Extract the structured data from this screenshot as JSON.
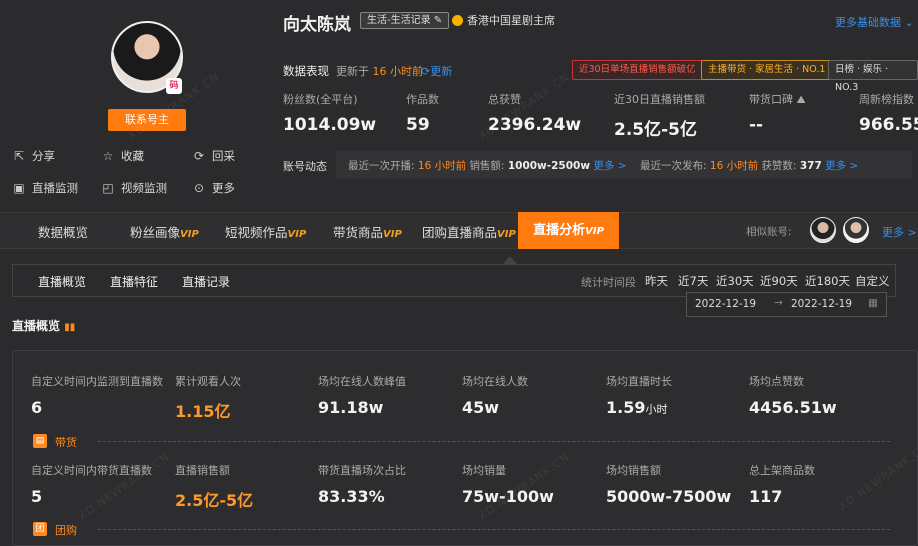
{
  "profile": {
    "name": "向太陈岚",
    "category_tag": "生活-生活记录",
    "certification": "香港中国星剧主席",
    "contact_label": "联系号主",
    "more_data_link": "更多基础数据"
  },
  "actions": [
    {
      "icon": "share-icon",
      "label": "分享"
    },
    {
      "icon": "star-icon",
      "label": "收藏"
    },
    {
      "icon": "refresh-icon",
      "label": "回采"
    },
    {
      "icon": "live-icon",
      "label": "直播监测"
    },
    {
      "icon": "video-icon",
      "label": "视频监测"
    },
    {
      "icon": "more-icon",
      "label": "更多"
    }
  ],
  "performance": {
    "label": "数据表现",
    "updated_prefix": "更新于",
    "updated_time": "16 小时前",
    "refresh_label": "更新",
    "badges": [
      "近30日单场直播销售额破亿",
      "主播带货 · 家居生活 · NO.1",
      "日榜 · 娱乐 · NO.3"
    ]
  },
  "stats": [
    {
      "label": "粉丝数(全平台)",
      "value": "1014.09w"
    },
    {
      "label": "作品数",
      "value": "59"
    },
    {
      "label": "总获赞",
      "value": "2396.24w"
    },
    {
      "label": "近30日直播销售额",
      "value": "2.5亿-5亿"
    },
    {
      "label": "带货口碑",
      "value": "--"
    },
    {
      "label": "周新榜指数",
      "value": "966.55"
    }
  ],
  "account_activity": {
    "label": "账号动态",
    "live_prefix": "最近一次开播:",
    "live_time": "16 小时前",
    "sales_label": "销售额:",
    "sales_value": "1000w-2500w",
    "more1": "更多 >",
    "post_prefix": "最近一次发布:",
    "post_time": "16 小时前",
    "likes_label": "获赞数:",
    "likes_value": "377",
    "more2": "更多 >"
  },
  "tabs": [
    {
      "label": "数据概览",
      "vip": ""
    },
    {
      "label": "粉丝画像",
      "vip": "VIP"
    },
    {
      "label": "短视频作品",
      "vip": "VIP"
    },
    {
      "label": "带货商品",
      "vip": "VIP"
    },
    {
      "label": "团购直播商品",
      "vip": "VIP"
    }
  ],
  "active_tab": {
    "label": "直播分析",
    "vip": "VIP"
  },
  "similar": {
    "label": "相似账号:",
    "more": "更多 >"
  },
  "subtabs": [
    "直播概览",
    "直播特征",
    "直播记录"
  ],
  "period": {
    "label": "统计时间段",
    "options": [
      "昨天",
      "近7天",
      "近30天",
      "近90天",
      "近180天",
      "自定义"
    ],
    "start": "2022-12-19",
    "end": "2022-12-19",
    "arrow": "→"
  },
  "section_title": "直播概览",
  "row1": [
    {
      "label": "自定义时间内监测到直播数",
      "value": "6",
      "unit": ""
    },
    {
      "label": "累计观看人次",
      "value": "1.15亿",
      "unit": ""
    },
    {
      "label": "场均在线人数峰值",
      "value": "91.18w",
      "unit": ""
    },
    {
      "label": "场均在线人数",
      "value": "45w",
      "unit": ""
    },
    {
      "label": "场均直播时长",
      "value": "1.59",
      "unit": "小时"
    },
    {
      "label": "场均点赞数",
      "value": "4456.51w",
      "unit": ""
    }
  ],
  "sec1": "带货",
  "row2": [
    {
      "label": "自定义时间内带货直播数",
      "value": "5"
    },
    {
      "label": "直播销售额",
      "value": "2.5亿-5亿"
    },
    {
      "label": "带货直播场次占比",
      "value": "83.33%"
    },
    {
      "label": "场均销量",
      "value": "75w-100w"
    },
    {
      "label": "场均销售额",
      "value": "5000w-7500w"
    },
    {
      "label": "总上架商品数",
      "value": "117"
    }
  ],
  "sec2": "团购",
  "watermark": "XD.NEWRANK.CN",
  "colors": {
    "accent": "#ff7a0f",
    "link": "#3a8ee6"
  }
}
